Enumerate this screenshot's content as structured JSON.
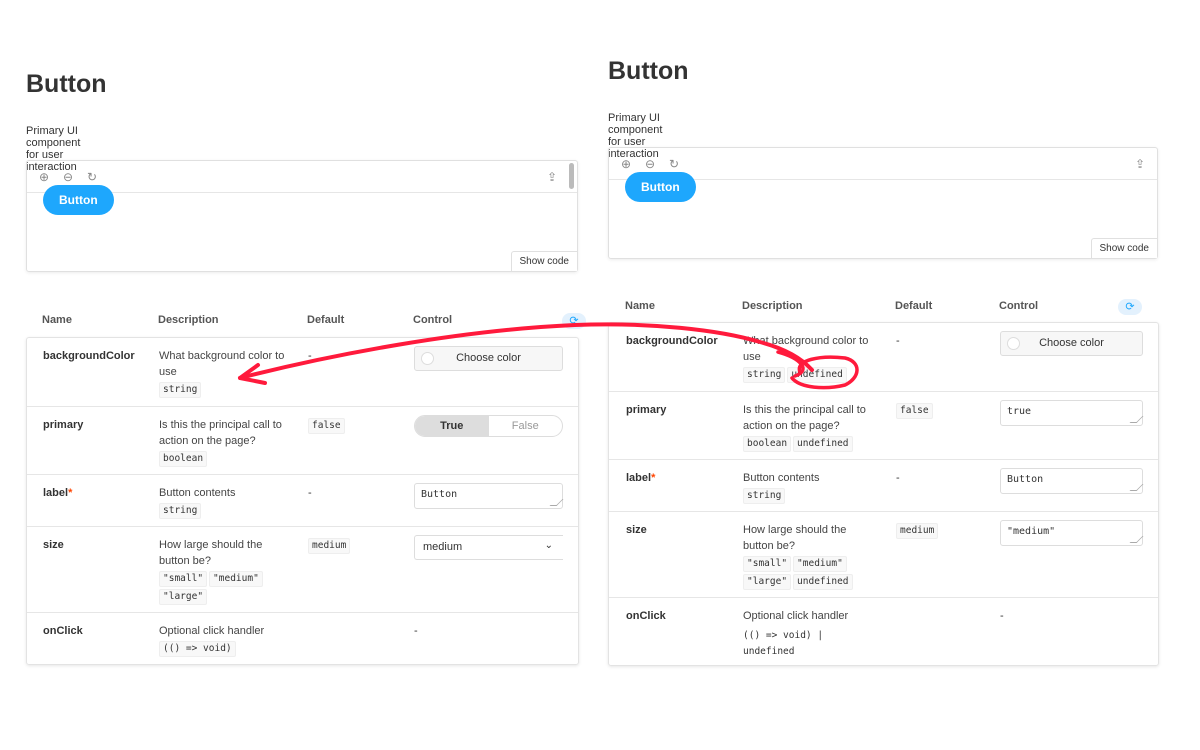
{
  "annotation_color": "#ff1a3c",
  "accent": "#1ea7fd",
  "toolbar_icons": [
    "zoom-in-icon",
    "zoom-out-icon",
    "reset-zoom-icon",
    "share-icon"
  ],
  "panels": [
    {
      "id": "left",
      "title": "Button",
      "subtitle": "Primary UI component for user interaction",
      "preview_button": "Button",
      "show_code": "Show code",
      "headers": {
        "name": "Name",
        "description": "Description",
        "default": "Default",
        "control": "Control"
      },
      "rows": [
        {
          "name": "backgroundColor",
          "required": false,
          "description": "What background color to use",
          "types": [
            "string"
          ],
          "default": "-",
          "control": {
            "type": "color",
            "label": "Choose color"
          }
        },
        {
          "name": "primary",
          "required": false,
          "description": "Is this the principal call to action on the page?",
          "types": [
            "boolean"
          ],
          "default_code": "false",
          "control": {
            "type": "toggle",
            "on": "True",
            "off": "False"
          }
        },
        {
          "name": "label",
          "required": true,
          "description": "Button contents",
          "types": [
            "string"
          ],
          "default": "-",
          "control": {
            "type": "text",
            "value": "Button"
          }
        },
        {
          "name": "size",
          "required": false,
          "description": "How large should the button be?",
          "types": [
            "\"small\"",
            "\"medium\"",
            "\"large\""
          ],
          "default_code": "medium",
          "control": {
            "type": "select",
            "value": "medium"
          }
        },
        {
          "name": "onClick",
          "required": false,
          "description": "Optional click handler",
          "types": [
            "(() => void)"
          ],
          "default": "",
          "control": {
            "type": "none",
            "value": "-"
          }
        }
      ]
    },
    {
      "id": "right",
      "title": "Button",
      "subtitle": "Primary UI component for user interaction",
      "preview_button": "Button",
      "show_code": "Show code",
      "headers": {
        "name": "Name",
        "description": "Description",
        "default": "Default",
        "control": "Control"
      },
      "rows": [
        {
          "name": "backgroundColor",
          "required": false,
          "description": "What background color to use",
          "types": [
            "string",
            "undefined"
          ],
          "default": "-",
          "control": {
            "type": "color",
            "label": "Choose color"
          }
        },
        {
          "name": "primary",
          "required": false,
          "description": "Is this the principal call to action on the page?",
          "types": [
            "boolean",
            "undefined"
          ],
          "default_code": "false",
          "control": {
            "type": "text",
            "value": "true"
          }
        },
        {
          "name": "label",
          "required": true,
          "description": "Button contents",
          "types": [
            "string"
          ],
          "default": "-",
          "control": {
            "type": "text",
            "value": "Button"
          }
        },
        {
          "name": "size",
          "required": false,
          "description": "How large should the button be?",
          "types": [
            "\"small\"",
            "\"medium\"",
            "\"large\"",
            "undefined"
          ],
          "default_code": "medium",
          "control": {
            "type": "text",
            "value": "\"medium\""
          }
        },
        {
          "name": "onClick",
          "required": false,
          "description": "Optional click handler",
          "plain_type": "(() => void) | undefined",
          "default": "",
          "control": {
            "type": "none",
            "value": "-"
          }
        }
      ]
    }
  ]
}
